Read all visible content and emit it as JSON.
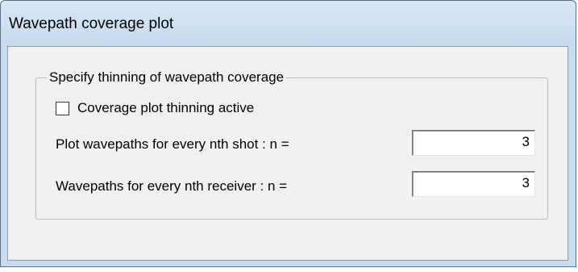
{
  "window": {
    "title": "Wavepath coverage plot"
  },
  "group": {
    "legend": "Specify thinning of wavepath coverage",
    "checkbox": {
      "label": "Coverage plot thinning active",
      "checked": false
    },
    "shot_field": {
      "label": "Plot wavepaths for every nth shot : n =",
      "value": "3"
    },
    "receiver_field": {
      "label": "Wavepaths for every nth  receiver : n =",
      "value": "3"
    }
  }
}
